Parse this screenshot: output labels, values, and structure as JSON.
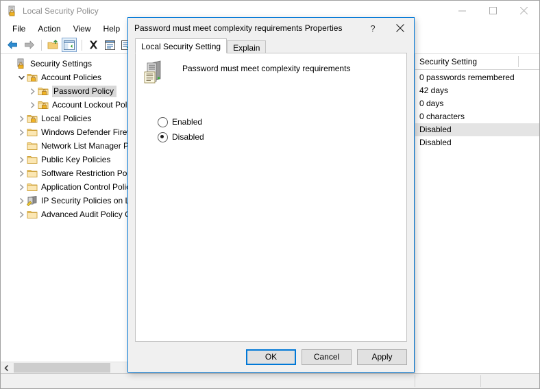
{
  "window": {
    "title": "Local Security Policy",
    "title_icon": "security-policy-icon",
    "controls": {
      "minimize": "—",
      "maximize": "□",
      "close": "✕"
    }
  },
  "menubar": {
    "items": [
      {
        "label": "File"
      },
      {
        "label": "Action"
      },
      {
        "label": "View"
      },
      {
        "label": "Help"
      }
    ]
  },
  "toolbar": {
    "buttons": [
      {
        "name": "back-arrow-icon",
        "tooltip": "Back"
      },
      {
        "name": "forward-arrow-icon",
        "tooltip": "Forward"
      },
      {
        "name": "up-one-level-icon",
        "tooltip": "Up One Level"
      },
      {
        "name": "show-hide-console-tree-icon",
        "tooltip": "Show/Hide Console Tree"
      },
      {
        "name": "delete-icon",
        "tooltip": "Delete"
      },
      {
        "name": "properties-icon",
        "tooltip": "Properties"
      },
      {
        "name": "export-list-icon",
        "tooltip": "Export List"
      }
    ]
  },
  "tree": {
    "nodes": [
      {
        "label": "Security Settings",
        "indent": 0,
        "twisty": "none",
        "icon": "security-settings-icon",
        "selected": false
      },
      {
        "label": "Account Policies",
        "indent": 1,
        "twisty": "expanded",
        "icon": "folder-lock-icon",
        "selected": false
      },
      {
        "label": "Password Policy",
        "indent": 2,
        "twisty": "collapsed",
        "icon": "folder-lock-icon",
        "selected": true
      },
      {
        "label": "Account Lockout Polic",
        "indent": 2,
        "twisty": "collapsed",
        "icon": "folder-lock-icon",
        "selected": false
      },
      {
        "label": "Local Policies",
        "indent": 1,
        "twisty": "collapsed",
        "icon": "folder-lock-icon",
        "selected": false
      },
      {
        "label": "Windows Defender Firewall",
        "indent": 1,
        "twisty": "collapsed",
        "icon": "folder-icon",
        "selected": false
      },
      {
        "label": "Network List Manager Poli",
        "indent": 1,
        "twisty": "none",
        "icon": "folder-icon",
        "selected": false
      },
      {
        "label": "Public Key Policies",
        "indent": 1,
        "twisty": "collapsed",
        "icon": "folder-icon",
        "selected": false
      },
      {
        "label": "Software Restriction Polici",
        "indent": 1,
        "twisty": "collapsed",
        "icon": "folder-icon",
        "selected": false
      },
      {
        "label": "Application Control Policie",
        "indent": 1,
        "twisty": "collapsed",
        "icon": "folder-icon",
        "selected": false
      },
      {
        "label": "IP Security Policies on Loc",
        "indent": 1,
        "twisty": "collapsed",
        "icon": "ip-security-icon",
        "selected": false
      },
      {
        "label": "Advanced Audit Policy Co",
        "indent": 1,
        "twisty": "collapsed",
        "icon": "folder-icon",
        "selected": false
      }
    ]
  },
  "list": {
    "column_header": "Security Setting",
    "rows": [
      {
        "value": "0 passwords remembered",
        "selected": false
      },
      {
        "value": "42 days",
        "selected": false
      },
      {
        "value": "0 days",
        "selected": false
      },
      {
        "value": "0 characters",
        "selected": false
      },
      {
        "value": "Disabled",
        "selected": true
      },
      {
        "value": "Disabled",
        "selected": false
      }
    ]
  },
  "statusbar": {
    "cells": [
      "",
      "",
      ""
    ]
  },
  "dialog": {
    "title": "Password must meet complexity requirements Properties",
    "help_label": "?",
    "close_label": "✕",
    "tabs": [
      {
        "label": "Local Security Setting",
        "active": true
      },
      {
        "label": "Explain",
        "active": false
      }
    ],
    "policy_icon": "policy-computer-icon",
    "policy_name": "Password must meet complexity requirements",
    "options": [
      {
        "label": "Enabled",
        "checked": false
      },
      {
        "label": "Disabled",
        "checked": true
      }
    ],
    "buttons": [
      {
        "label": "OK",
        "default": true
      },
      {
        "label": "Cancel",
        "default": false
      },
      {
        "label": "Apply",
        "default": false
      }
    ]
  },
  "colors": {
    "accent": "#0078d7",
    "selection": "#d8d8d8",
    "folder": "#f6d186",
    "window_bg": "#f0f0f0"
  }
}
